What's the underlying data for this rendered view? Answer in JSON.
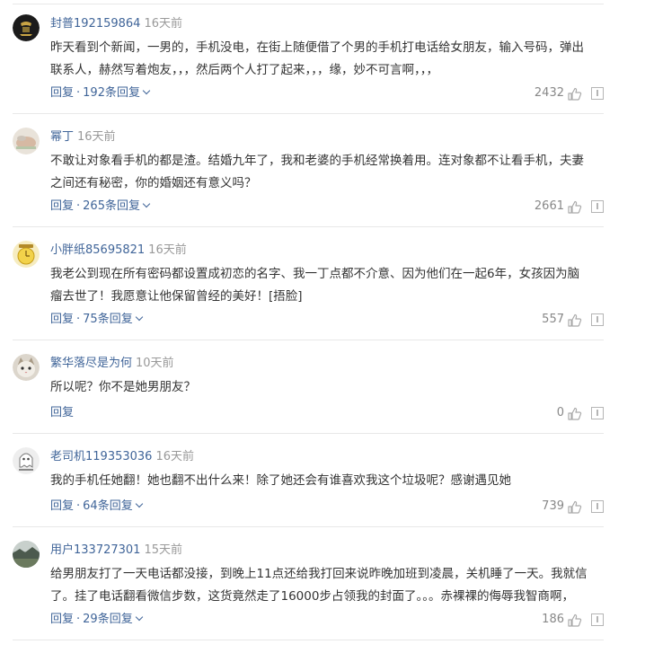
{
  "labels": {
    "reply": "回复",
    "dot": "·"
  },
  "comments": [
    {
      "username": "封普192159864",
      "time": "16天前",
      "lines": [
        "昨天看到个新闻，一男的，手机没电，在街上随便借了个男的手机打电话给女朋友，输入号码，弹出",
        "联系人，赫然写着炮友，，，然后两个人打了起来，，，缘，妙不可言啊，，，"
      ],
      "replies": "192条回复",
      "likes": "2432",
      "avatar_icon": "dark-emblem-avatar"
    },
    {
      "username": "幂丁",
      "time": "16天前",
      "lines": [
        "不敢让对象看手机的都是渣。结婚九年了，我和老婆的手机经常换着用。连对象都不让看手机，夫妻",
        "之间还有秘密，你的婚姻还有意义吗？"
      ],
      "replies": "265条回复",
      "likes": "2661",
      "avatar_icon": "hand-photo-avatar"
    },
    {
      "username": "小胖纸85695821",
      "time": "16天前",
      "lines": [
        "我老公到现在所有密码都设置成初恋的名字、我一丁点都不介意、因为他们在一起6年，女孩因为脑",
        "瘤去世了！我愿意让他保留曾经的美好！[捂脸]"
      ],
      "replies": "75条回复",
      "likes": "557",
      "avatar_icon": "smile-clock-avatar"
    },
    {
      "username": "繁华落尽是为何",
      "time": "10天前",
      "lines": [
        "所以呢？你不是她男朋友？"
      ],
      "replies": "",
      "likes": "0",
      "avatar_icon": "cat-avatar"
    },
    {
      "username": "老司机119353036",
      "time": "16天前",
      "lines": [
        "我的手机任她翻！她也翻不出什么来！除了她还会有谁喜欢我这个垃圾呢？感谢遇见她"
      ],
      "replies": "64条回复",
      "likes": "739",
      "avatar_icon": "ghost-avatar"
    },
    {
      "username": "用户133727301",
      "time": "15天前",
      "lines": [
        "给男朋友打了一天电话都没接，到晚上11点还给我打回来说昨晚加班到凌晨，关机睡了一天。我就信",
        "了。挂了电话翻看微信步数，这货竟然走了16000步占领我的封面了。。。赤裸裸的侮辱我智商啊，"
      ],
      "replies": "29条回复",
      "likes": "186",
      "avatar_icon": "landscape-avatar"
    }
  ]
}
